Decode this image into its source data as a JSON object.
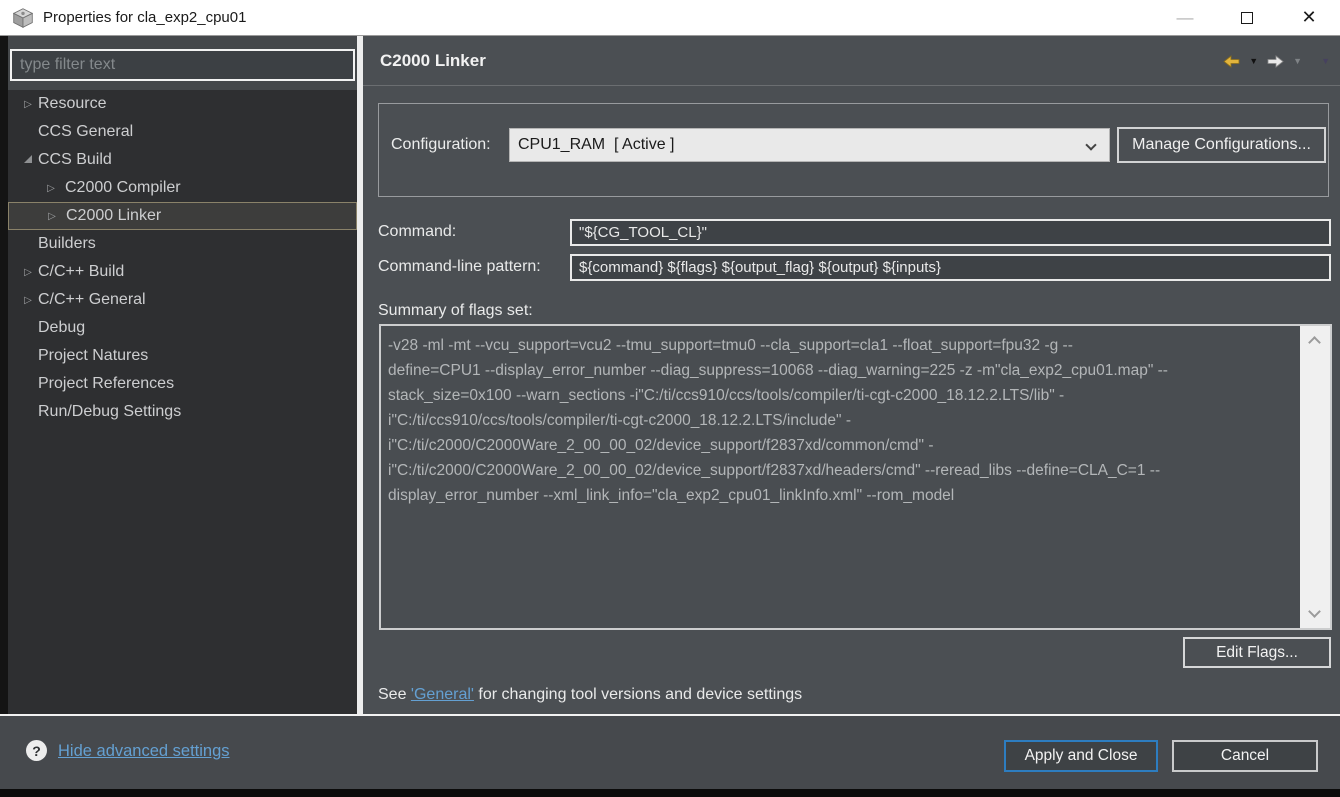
{
  "window": {
    "title": "Properties for cla_exp2_cpu01",
    "controls": {
      "minimize": "—",
      "close": "✕"
    }
  },
  "sidebar": {
    "filter_placeholder": "type filter text",
    "tree": [
      {
        "label": "Resource",
        "arrow": "collapsed",
        "indent": 0,
        "selected": false
      },
      {
        "label": "CCS General",
        "arrow": "none",
        "indent": 0,
        "selected": false
      },
      {
        "label": "CCS Build",
        "arrow": "expanded",
        "indent": 0,
        "selected": false
      },
      {
        "label": "C2000 Compiler",
        "arrow": "collapsed",
        "indent": 1,
        "selected": false
      },
      {
        "label": "C2000 Linker",
        "arrow": "collapsed",
        "indent": 1,
        "selected": true
      },
      {
        "label": "Builders",
        "arrow": "none",
        "indent": 0,
        "selected": false
      },
      {
        "label": "C/C++ Build",
        "arrow": "collapsed",
        "indent": 0,
        "selected": false
      },
      {
        "label": "C/C++ General",
        "arrow": "collapsed",
        "indent": 0,
        "selected": false
      },
      {
        "label": "Debug",
        "arrow": "none",
        "indent": 0,
        "selected": false
      },
      {
        "label": "Project Natures",
        "arrow": "none",
        "indent": 0,
        "selected": false
      },
      {
        "label": "Project References",
        "arrow": "none",
        "indent": 0,
        "selected": false
      },
      {
        "label": "Run/Debug Settings",
        "arrow": "none",
        "indent": 0,
        "selected": false
      }
    ]
  },
  "main": {
    "title": "C2000 Linker",
    "configuration": {
      "label": "Configuration:",
      "value": "CPU1_RAM  [ Active ]",
      "manage_button": "Manage Configurations..."
    },
    "command": {
      "label": "Command:",
      "value": "\"${CG_TOOL_CL}\""
    },
    "pattern": {
      "label": "Command-line pattern:",
      "value": "${command} ${flags} ${output_flag} ${output} ${inputs}"
    },
    "flags": {
      "label": "Summary of flags set:",
      "lines": [
        "-v28 -ml -mt --vcu_support=vcu2 --tmu_support=tmu0 --cla_support=cla1 --float_support=fpu32 -g --",
        "define=CPU1 --display_error_number --diag_suppress=10068 --diag_warning=225 -z -m\"cla_exp2_cpu01.map\" --",
        "stack_size=0x100 --warn_sections -i\"C:/ti/ccs910/ccs/tools/compiler/ti-cgt-c2000_18.12.2.LTS/lib\" -",
        "i\"C:/ti/ccs910/ccs/tools/compiler/ti-cgt-c2000_18.12.2.LTS/include\" -",
        "i\"C:/ti/c2000/C2000Ware_2_00_00_02/device_support/f2837xd/common/cmd\" -",
        "i\"C:/ti/c2000/C2000Ware_2_00_00_02/device_support/f2837xd/headers/cmd\" --reread_libs --define=CLA_C=1 --",
        "display_error_number --xml_link_info=\"cla_exp2_cpu01_linkInfo.xml\" --rom_model"
      ],
      "edit_button": "Edit Flags..."
    },
    "footer_note": {
      "prefix": "See ",
      "link": "'General'",
      "suffix": " for changing tool versions and device settings"
    }
  },
  "bottom_bar": {
    "help_icon": "?",
    "toggle_link": "Hide advanced settings",
    "apply_button": "Apply and Close",
    "cancel_button": "Cancel"
  },
  "colors": {
    "panel_gray": "#4b4f53",
    "sidebar_dark": "#2e2f31",
    "selection_border": "#8a8269",
    "link_blue": "#64a0d2",
    "apply_border_blue": "#2d7dc0",
    "back_arrow_gold": "#e2b43c",
    "combo_fill": "#e9e9e9"
  }
}
